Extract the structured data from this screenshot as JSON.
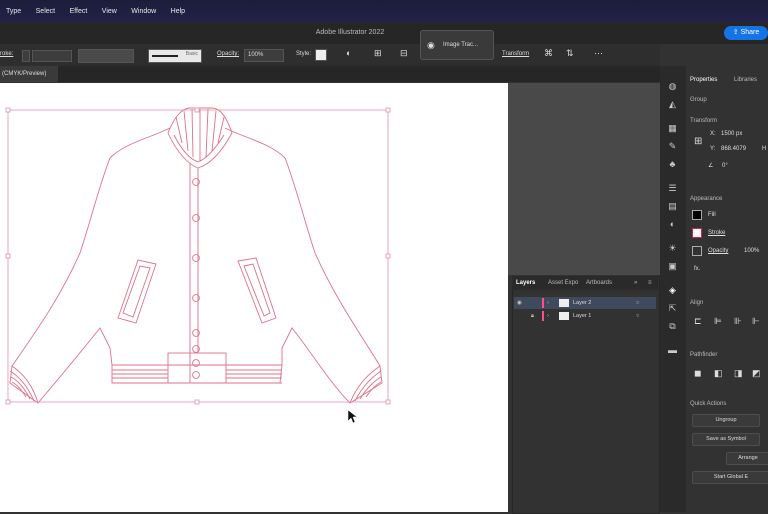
{
  "menu": [
    "Type",
    "Select",
    "Effect",
    "View",
    "Window",
    "Help"
  ],
  "app_title": "Adobe Illustrator 2022",
  "share_label": "Share",
  "image_trace_label": "Image Trac...",
  "control_bar": {
    "stroke_label": "roke:",
    "brush_label": "Basic",
    "opacity_label": "Opacity:",
    "opacity_value": "100%",
    "style_label": "Style:",
    "transform_label": "Transform"
  },
  "doc_tab": "(CMYK/Preview)",
  "layers_panel": {
    "tabs": [
      "Layers",
      "Asset Expo",
      "Artboards"
    ],
    "layers": [
      {
        "name": "Layer 2",
        "color": "#ff4f8b",
        "selected": true
      },
      {
        "name": "Layer 1",
        "color": "#ff4f8b",
        "selected": false
      }
    ]
  },
  "properties": {
    "tabs": [
      "Properties",
      "Libraries"
    ],
    "selection": "Group",
    "transform_header": "Transform",
    "x_label": "X:",
    "x_value": "1500 px",
    "y_label": "Y:",
    "y_value": "868.4079",
    "h_label": "H",
    "angle_value": "0°",
    "appearance_header": "Appearance",
    "fill_label": "Fill",
    "stroke_label": "Stroke",
    "opacity_label": "Opacity",
    "opacity_value": "100%",
    "fx_label": "fx.",
    "align_header": "Align",
    "pathfinder_header": "Pathfinder",
    "quick_actions_header": "Quick Actions",
    "ungroup_label": "Ungroup",
    "save_symbol_label": "Save as Symbol",
    "arrange_label": "Arrange",
    "start_global_label": "Start Global E"
  },
  "colors": {
    "outline": "#e0708a",
    "selection": "#e890a8",
    "accent": "#1473e6"
  }
}
